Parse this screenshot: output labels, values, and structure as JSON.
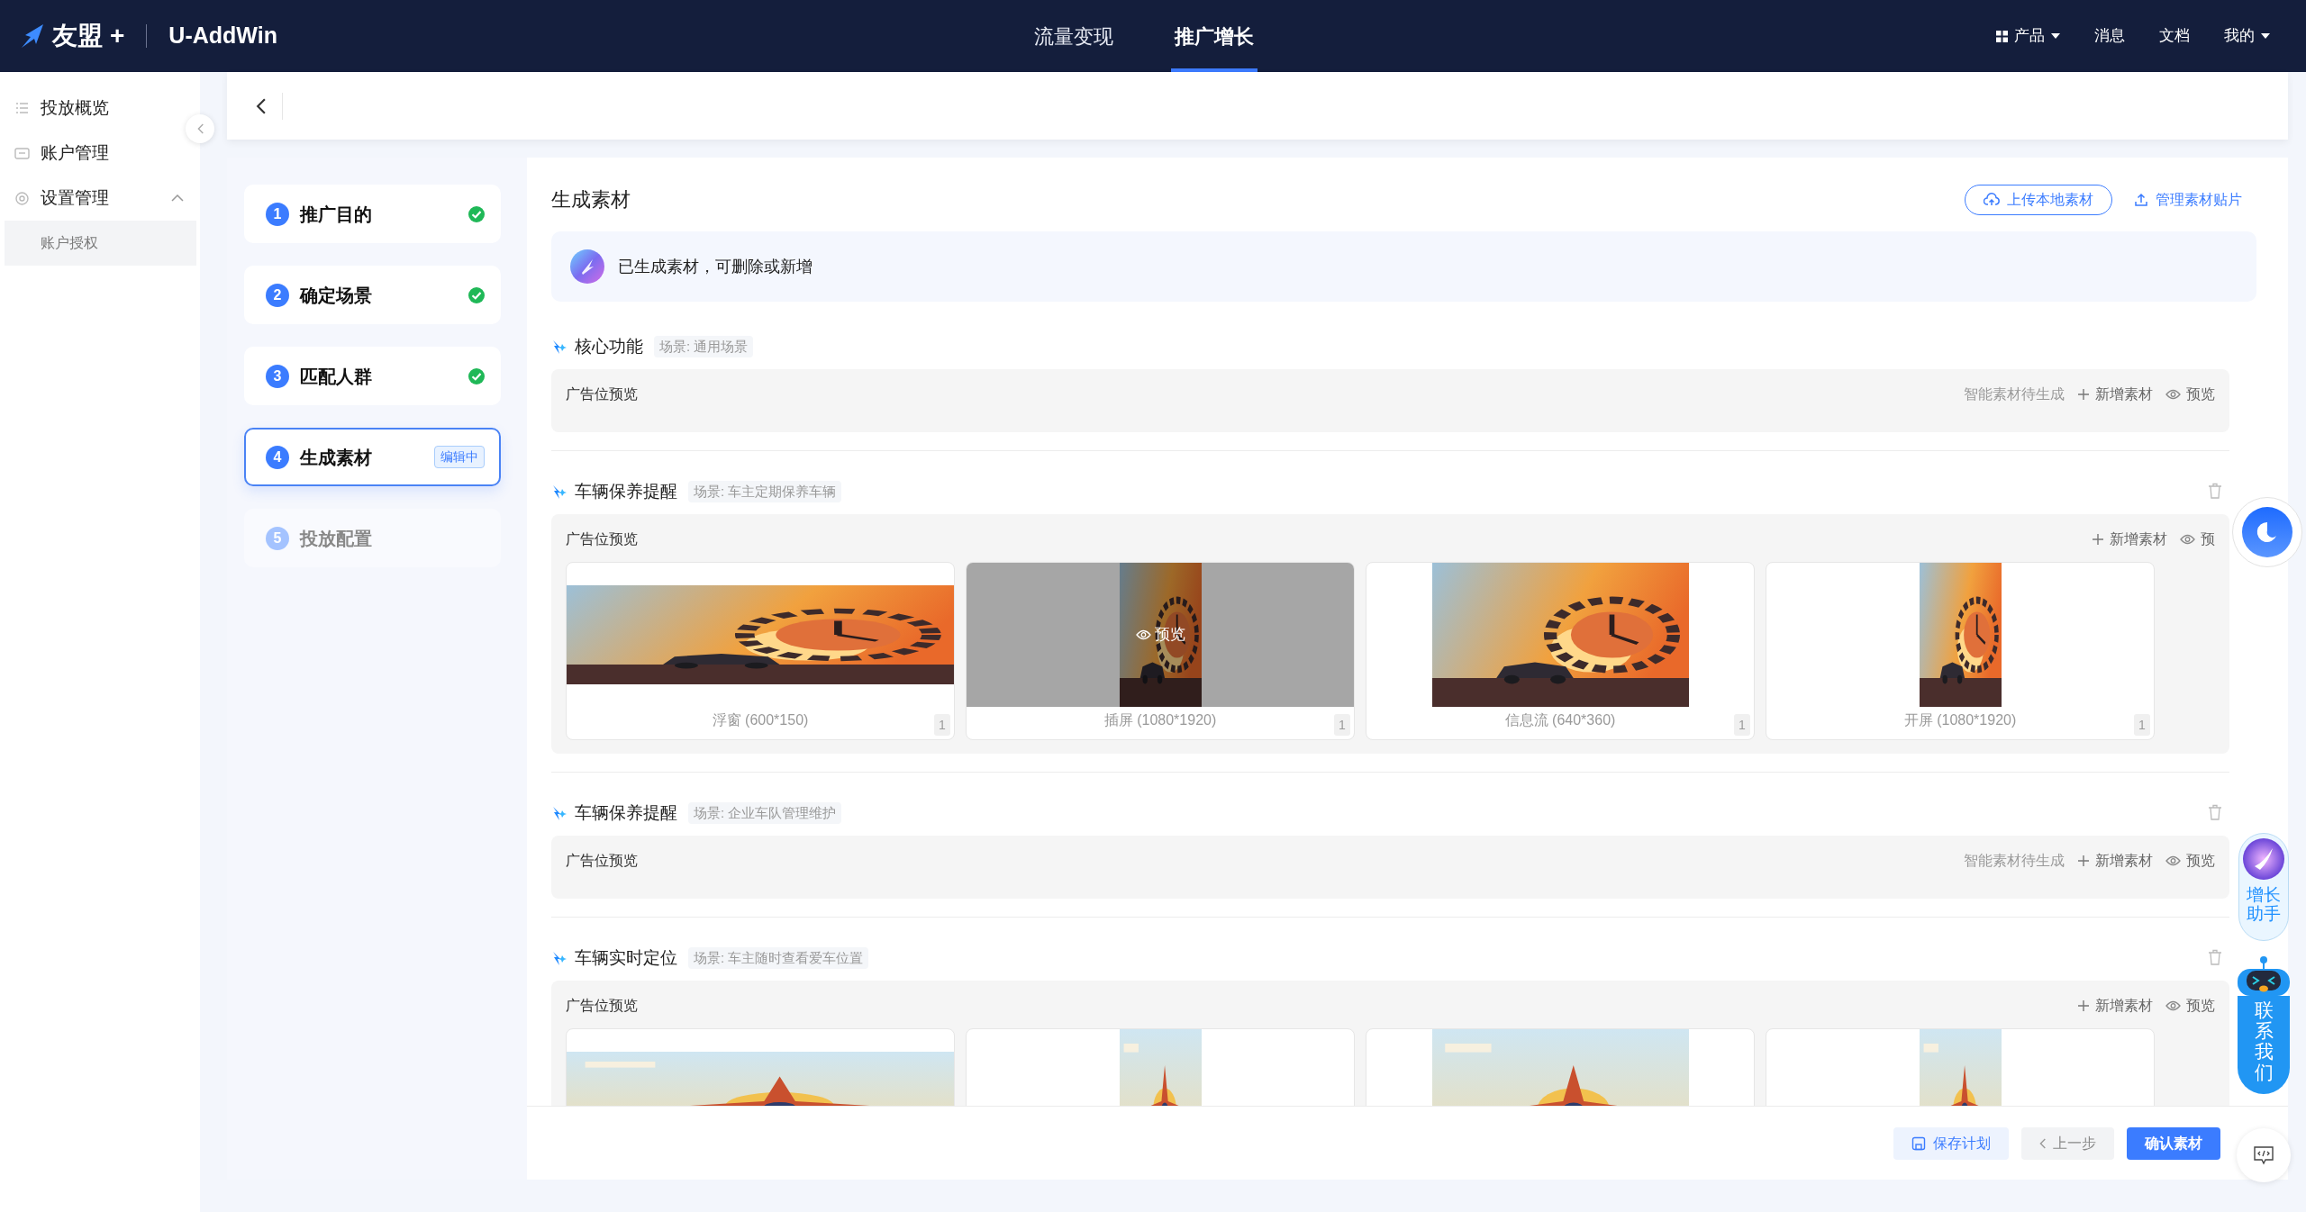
{
  "header": {
    "logo": "友盟",
    "logo_plus": "+",
    "product": "U-AddWin",
    "nav": [
      {
        "label": "流量变现",
        "selected": false
      },
      {
        "label": "推广增长",
        "selected": true
      }
    ],
    "menu": [
      {
        "label": "产品",
        "kind": "grid-dropdown"
      },
      {
        "label": "消息",
        "kind": "link"
      },
      {
        "label": "文档",
        "kind": "link"
      },
      {
        "label": "我的",
        "kind": "dropdown"
      }
    ]
  },
  "sidebar": {
    "items": [
      {
        "label": "投放概览",
        "selected": false
      },
      {
        "label": "账户管理",
        "selected": false
      },
      {
        "label": "设置管理",
        "selected": false,
        "expanded": true,
        "children": [
          {
            "label": "账户授权",
            "selected": true
          }
        ]
      }
    ]
  },
  "steps": [
    {
      "number": "1",
      "label": "推广目的",
      "completed": true,
      "selected": false,
      "disabled": false
    },
    {
      "number": "2",
      "label": "确定场景",
      "completed": true,
      "selected": false,
      "disabled": false
    },
    {
      "number": "3",
      "label": "匹配人群",
      "completed": true,
      "selected": false,
      "disabled": false
    },
    {
      "number": "4",
      "label": "生成素材",
      "completed": false,
      "selected": true,
      "disabled": false,
      "badge": "编辑中"
    },
    {
      "number": "5",
      "label": "投放配置",
      "completed": false,
      "selected": false,
      "disabled": true
    }
  ],
  "panel": {
    "title": "生成素材",
    "buttons": [
      {
        "label": "上传本地素材",
        "kind": "outline"
      },
      {
        "label": "管理素材贴片",
        "kind": "link"
      }
    ],
    "notice": "已生成素材，可删除或新增",
    "sections": [
      {
        "title": "核心功能",
        "scene": "场景: 通用场景",
        "preview_label": "广告位预览",
        "status": "智能素材待生成",
        "actions": [
          "新增素材",
          "预览"
        ],
        "deletable": false
      },
      {
        "title": "车辆保养提醒",
        "scene": "场景: 车主定期保养车辆",
        "preview_label": "广告位预览",
        "actions": [
          "新增素材",
          "预"
        ],
        "deletable": true,
        "cards": [
          {
            "kind": "picture",
            "label": "浮窗 (600*150)",
            "count": "1"
          },
          {
            "kind": "picture",
            "label": "插屏 (1080*1920)",
            "count": "1",
            "overlay": "预览"
          },
          {
            "kind": "picture",
            "label": "信息流 (640*360)",
            "count": "1"
          },
          {
            "kind": "picture",
            "label": "开屏 (1080*1920)",
            "count": "1"
          }
        ]
      },
      {
        "title": "车辆保养提醒",
        "scene": "场景: 企业车队管理维护",
        "preview_label": "广告位预览",
        "status": "智能素材待生成",
        "actions": [
          "新增素材",
          "预览"
        ],
        "deletable": true
      },
      {
        "title": "车辆实时定位",
        "scene": "场景: 车主随时查看爱车位置",
        "preview_label": "广告位预览",
        "actions": [
          "新增素材",
          "预览"
        ],
        "deletable": true,
        "cards": [
          {
            "kind": "picture"
          },
          {
            "kind": "picture"
          },
          {
            "kind": "picture"
          },
          {
            "kind": "picture"
          }
        ]
      }
    ],
    "footer_buttons": [
      {
        "label": "保存计划",
        "kind": "light"
      },
      {
        "label": "上一步",
        "kind": "secondary"
      },
      {
        "label": "确认素材",
        "kind": "primary"
      }
    ]
  },
  "widgets": {
    "assistant": "增长助手",
    "contact": "联系我们"
  }
}
